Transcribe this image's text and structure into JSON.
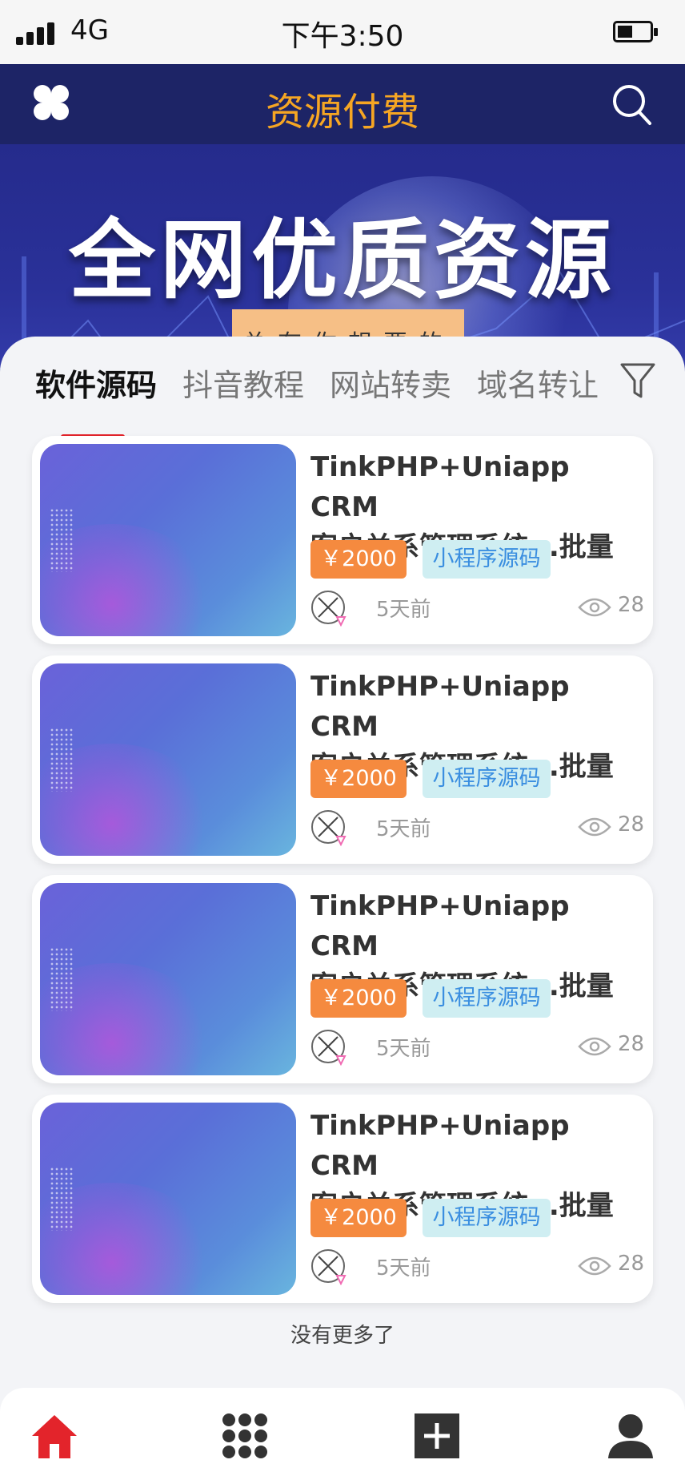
{
  "status_bar": {
    "network": "4G",
    "time": "下午3:50"
  },
  "header": {
    "title": "资源付费"
  },
  "banner": {
    "title": "全网优质资源",
    "tag": "总有你想要的"
  },
  "tabs": [
    {
      "label": "软件源码",
      "active": true
    },
    {
      "label": "抖音教程",
      "active": false
    },
    {
      "label": "网站转卖",
      "active": false
    },
    {
      "label": "域名转让",
      "active": false
    }
  ],
  "items": [
    {
      "title": "TinkPHP+Uniapp CRM\n客户关系管理系统...批量",
      "price": "￥2000",
      "tag": "小程序源码",
      "time": "5天前",
      "views": "28"
    },
    {
      "title": "TinkPHP+Uniapp CRM\n客户关系管理系统...批量",
      "price": "￥2000",
      "tag": "小程序源码",
      "time": "5天前",
      "views": "28"
    },
    {
      "title": "TinkPHP+Uniapp CRM\n客户关系管理系统...批量",
      "price": "￥2000",
      "tag": "小程序源码",
      "time": "5天前",
      "views": "28"
    },
    {
      "title": "TinkPHP+Uniapp CRM\n客户关系管理系统...批量",
      "price": "￥2000",
      "tag": "小程序源码",
      "time": "5天前",
      "views": "28"
    }
  ],
  "footer": {
    "no_more": "没有更多了"
  },
  "colors": {
    "accent": "#e3242b",
    "title": "#f6a623",
    "nav_bg": "#1d2466",
    "price_bg": "#f58a3f",
    "tag_bg": "#cfeef2",
    "tag_text": "#3a8ee0"
  },
  "icons": {
    "menu": "four-petal-menu-icon",
    "search": "search-icon",
    "filter": "filter-icon",
    "avatar": "user-avatar-icon",
    "views": "eye-icon"
  },
  "bottom_nav": [
    {
      "name": "home",
      "icon": "home-icon",
      "active": true
    },
    {
      "name": "categories",
      "icon": "grid-icon",
      "active": false
    },
    {
      "name": "publish",
      "icon": "plus-square-icon",
      "active": false
    },
    {
      "name": "profile",
      "icon": "user-icon",
      "active": false
    }
  ]
}
